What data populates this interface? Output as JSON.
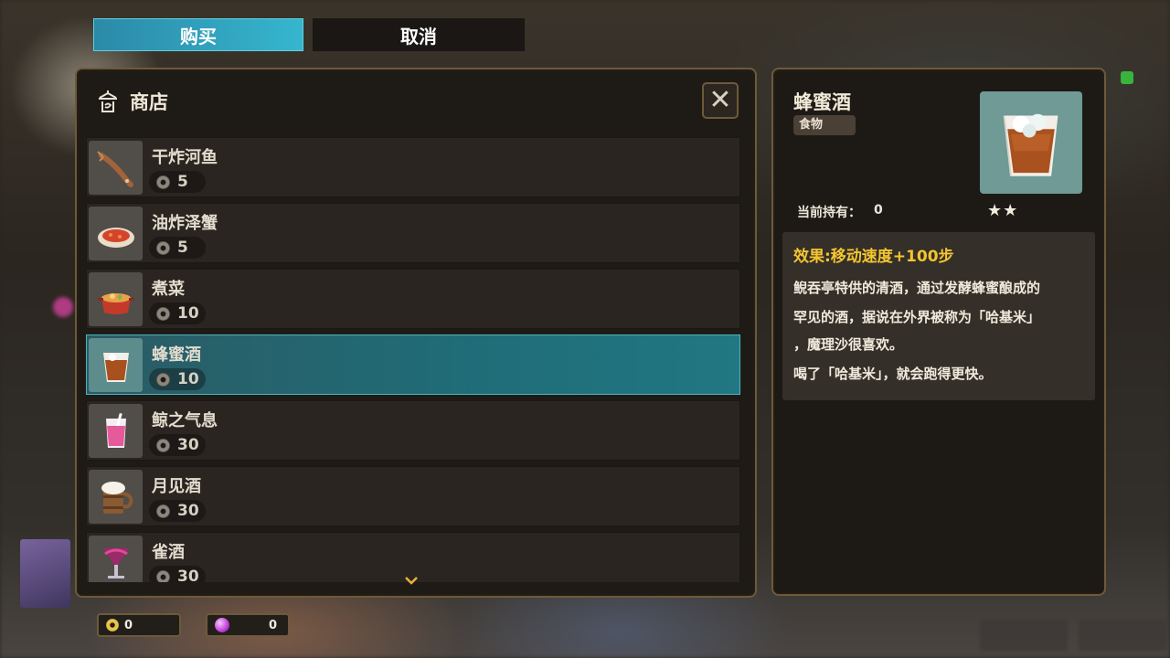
{
  "tabs": {
    "buy": "购买",
    "cancel": "取消"
  },
  "shop": {
    "title": "商店",
    "close_symbol": "✕",
    "items": [
      {
        "name": "干炸河鱼",
        "price": "5",
        "icon": "fried-fish-icon"
      },
      {
        "name": "油炸泽蟹",
        "price": "5",
        "icon": "fried-crab-icon"
      },
      {
        "name": "煮菜",
        "price": "10",
        "icon": "stew-pot-icon"
      },
      {
        "name": "蜂蜜酒",
        "price": "10",
        "icon": "honey-wine-icon",
        "selected": true
      },
      {
        "name": "鲸之气息",
        "price": "30",
        "icon": "pink-drink-icon"
      },
      {
        "name": "月见酒",
        "price": "30",
        "icon": "beer-mug-icon"
      },
      {
        "name": "雀酒",
        "price": "30",
        "icon": "cocktail-icon"
      }
    ]
  },
  "detail": {
    "name": "蜂蜜酒",
    "category": "食物",
    "held_label": "当前持有：",
    "held_value": "0",
    "stars": "★★",
    "rarity": 2,
    "effect": "效果:移动速度+100步",
    "description_lines": [
      "鲵吞亭特供的清酒，通过发酵蜂蜜酿成的",
      "罕见的酒，据说在外界被称为「哈基米」",
      "，魔理沙很喜欢。",
      "喝了「哈基米」，就会跑得更快。"
    ]
  },
  "currency": {
    "coins": "0",
    "orbs": "0"
  },
  "colors": {
    "selected_row": "#217783",
    "effect_text": "#f4c531",
    "panel_border": "#6d5a3a"
  }
}
